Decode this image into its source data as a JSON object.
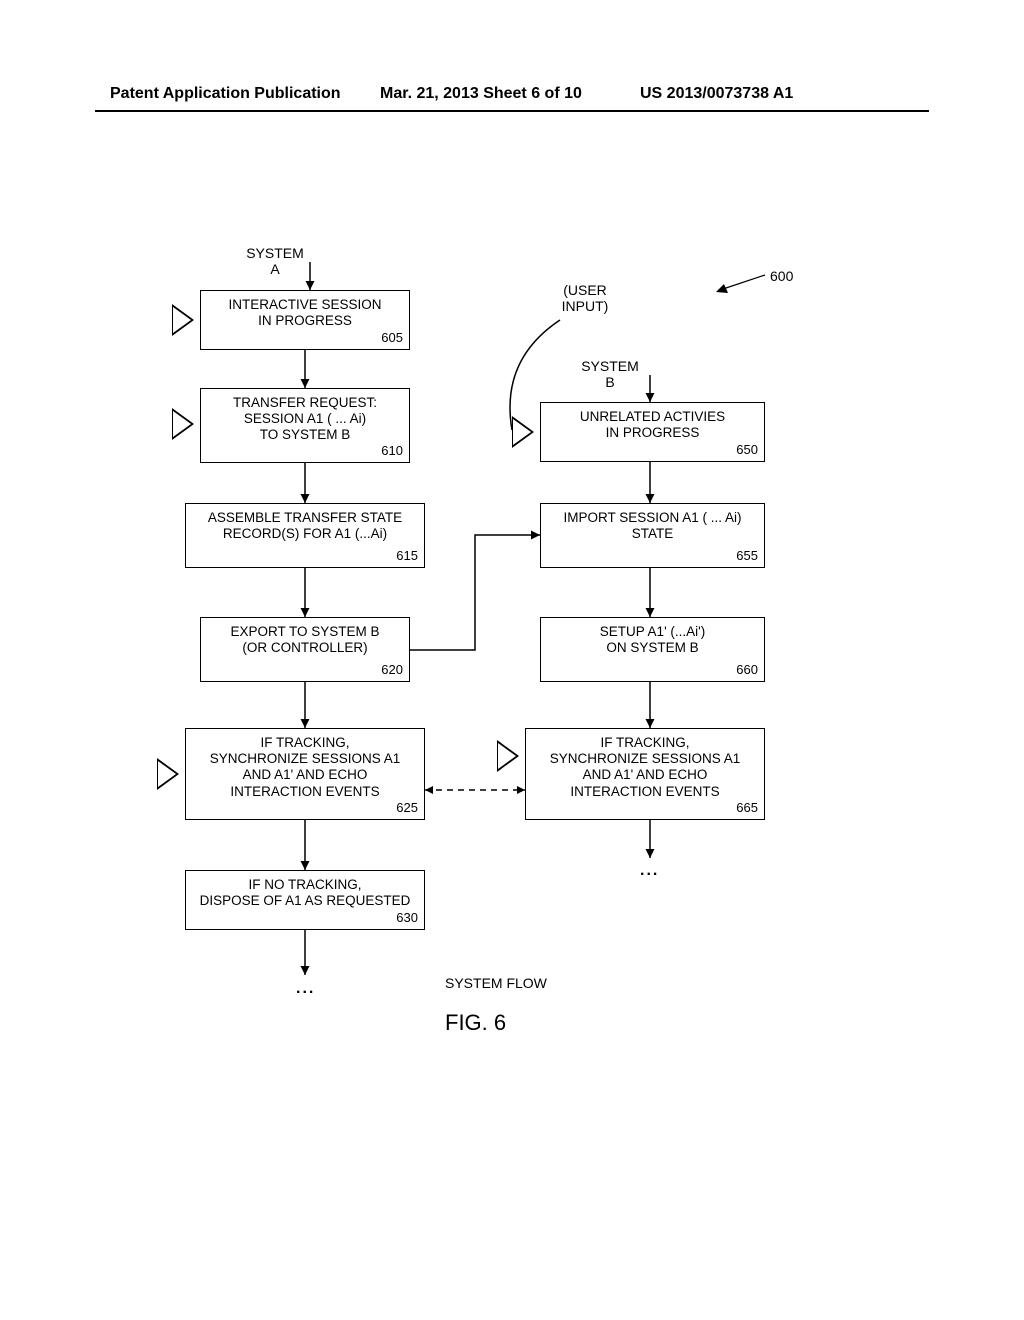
{
  "header": {
    "left": "Patent Application Publication",
    "mid": "Mar. 21, 2013  Sheet 6 of 10",
    "right": "US 2013/0073738 A1"
  },
  "labels": {
    "system_a": "SYSTEM\nA",
    "system_b": "SYSTEM\nB",
    "user_input": "(USER\nINPUT)",
    "ref600": "600",
    "system_flow": "SYSTEM FLOW",
    "figure": "FIG. 6",
    "dots": "..."
  },
  "boxes": {
    "b605": {
      "text": "INTERACTIVE SESSION\nIN PROGRESS",
      "num": "605"
    },
    "b610": {
      "text": "TRANSFER REQUEST:\nSESSION A1 ( ... Ai)\nTO SYSTEM B",
      "num": "610"
    },
    "b615": {
      "text": "ASSEMBLE TRANSFER STATE\nRECORD(S) FOR A1 (...Ai)",
      "num": "615"
    },
    "b620": {
      "text": "EXPORT TO SYSTEM B\n(OR CONTROLLER)",
      "num": "620"
    },
    "b625": {
      "text": "IF TRACKING,\nSYNCHRONIZE SESSIONS A1\nAND A1' AND ECHO\nINTERACTION EVENTS",
      "num": "625"
    },
    "b630": {
      "text": "IF NO TRACKING,\nDISPOSE OF A1 AS REQUESTED",
      "num": "630"
    },
    "b650": {
      "text": "UNRELATED ACTIVIES\nIN PROGRESS",
      "num": "650"
    },
    "b655": {
      "text": "IMPORT SESSION A1 ( ... Ai)\nSTATE",
      "num": "655"
    },
    "b660": {
      "text": "SETUP A1' (...Ai')\nON SYSTEM B",
      "num": "660"
    },
    "b665": {
      "text": "IF TRACKING,\nSYNCHRONIZE SESSIONS A1\nAND A1' AND ECHO\nINTERACTION EVENTS",
      "num": "665"
    }
  }
}
